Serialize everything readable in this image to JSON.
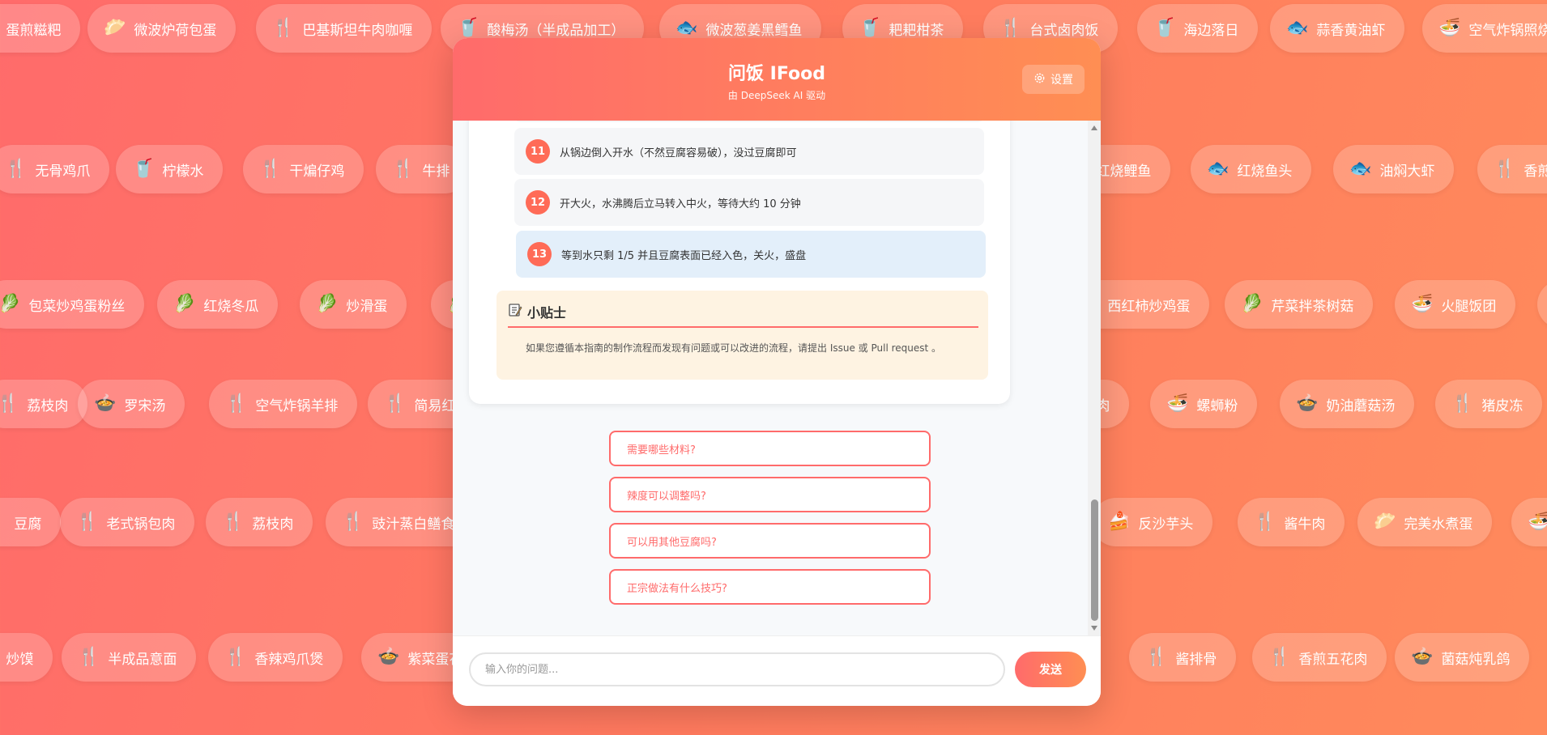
{
  "background": {
    "rows": [
      {
        "chips": [
          {
            "label": "蛋煎糍粑",
            "icon": "🍴"
          },
          {
            "label": "微波炉荷包蛋",
            "icon": "🥟"
          },
          {
            "label": "巴基斯坦牛肉咖喱",
            "icon": "🍴"
          },
          {
            "label": "酸梅汤（半成品加工）",
            "icon": "🥤"
          },
          {
            "label": "微波葱姜黑鳕鱼",
            "icon": "🐟"
          },
          {
            "label": "耙耙柑茶",
            "icon": "🥤"
          },
          {
            "label": "台式卤肉饭",
            "icon": "🍴"
          },
          {
            "label": "海边落日",
            "icon": "🥤"
          },
          {
            "label": "蒜香黄油虾",
            "icon": "🐟"
          },
          {
            "label": "空气炸锅照烧鸡",
            "icon": "🍜"
          }
        ]
      },
      {
        "chips": [
          {
            "label": "无骨鸡爪",
            "icon": "🍴"
          },
          {
            "label": "柠檬水",
            "icon": "🥤"
          },
          {
            "label": "干煸仔鸡",
            "icon": "🍴"
          },
          {
            "label": "牛排",
            "icon": "🍴"
          },
          {
            "label": "红烧鲤鱼",
            "icon": "🐟"
          },
          {
            "label": "红烧鱼头",
            "icon": "🐟"
          },
          {
            "label": "油焖大虾",
            "icon": "🐟"
          },
          {
            "label": "香煎三文鱼",
            "icon": "🍴"
          }
        ]
      },
      {
        "chips": [
          {
            "label": "包菜炒鸡蛋粉丝",
            "icon": "🥬"
          },
          {
            "label": "红烧冬瓜",
            "icon": "🥬"
          },
          {
            "label": "炒滑蛋",
            "icon": "🥬"
          },
          {
            "label": "",
            "icon": "🥬"
          },
          {
            "label": "西红柿炒鸡蛋",
            "icon": "🥬"
          },
          {
            "label": "芹菜拌茶树菇",
            "icon": "🥬"
          },
          {
            "label": "火腿饭团",
            "icon": "🍜"
          },
          {
            "label": "",
            "icon": "🍜"
          }
        ]
      },
      {
        "chips": [
          {
            "label": "荔枝肉",
            "icon": "🍴"
          },
          {
            "label": "罗宋汤",
            "icon": "🍲"
          },
          {
            "label": "空气炸锅羊排",
            "icon": "🍴"
          },
          {
            "label": "简易红烧",
            "icon": "🍴"
          },
          {
            "label": "肉",
            "icon": "🍴"
          },
          {
            "label": "螺蛳粉",
            "icon": "🍜"
          },
          {
            "label": "奶油蘑菇汤",
            "icon": "🍲"
          },
          {
            "label": "猪皮冻",
            "icon": "🍴"
          }
        ]
      },
      {
        "chips": [
          {
            "label": "豆腐",
            "icon": "🍴"
          },
          {
            "label": "老式锅包肉",
            "icon": "🍴"
          },
          {
            "label": "荔枝肉",
            "icon": "🍴"
          },
          {
            "label": "豉汁蒸白鳝食谱",
            "icon": "🍴"
          },
          {
            "label": "反沙芋头",
            "icon": "🍰"
          },
          {
            "label": "酱牛肉",
            "icon": "🍴"
          },
          {
            "label": "完美水煮蛋",
            "icon": "🥟"
          },
          {
            "label": "",
            "icon": "🍜"
          }
        ]
      },
      {
        "chips": [
          {
            "label": "炒馍",
            "icon": "🍴"
          },
          {
            "label": "半成品意面",
            "icon": "🍴"
          },
          {
            "label": "香辣鸡爪煲",
            "icon": "🍴"
          },
          {
            "label": "紫菜蛋花汤",
            "icon": "🍲"
          },
          {
            "label": "酱排骨",
            "icon": "🍴"
          },
          {
            "label": "香煎五花肉",
            "icon": "🍴"
          },
          {
            "label": "菌菇炖乳鸽",
            "icon": "🍲"
          }
        ]
      }
    ]
  },
  "header": {
    "title": "问饭 IFood",
    "subtitle": "由 DeepSeek AI 驱动",
    "settings_icon": "gear-icon",
    "settings_label": "设置"
  },
  "steps": [
    {
      "num": "11",
      "text": "从锅边倒入开水（不然豆腐容易破），没过豆腐即可"
    },
    {
      "num": "12",
      "text": "开大火，水沸腾后立马转入中火，等待大约 10 分钟"
    },
    {
      "num": "13",
      "text": "等到水只剩 1/5 并且豆腐表面已经入色，关火，盛盘"
    }
  ],
  "tips": {
    "icon": "memo-icon",
    "title": "小贴士",
    "text": "如果您遵循本指南的制作流程而发现有问题或可以改进的流程，请提出 Issue 或 Pull request 。"
  },
  "suggestions": [
    "需要哪些材料?",
    "辣度可以调整吗?",
    "可以用其他豆腐吗?",
    "正宗做法有什么技巧?"
  ],
  "composer": {
    "placeholder": "输入你的问题...",
    "send_label": "发送"
  },
  "colors": {
    "accent": "#ff6b6b",
    "accent2": "#ff8e53",
    "active_step": "#e3effa",
    "tips_bg": "#fef3e2"
  }
}
